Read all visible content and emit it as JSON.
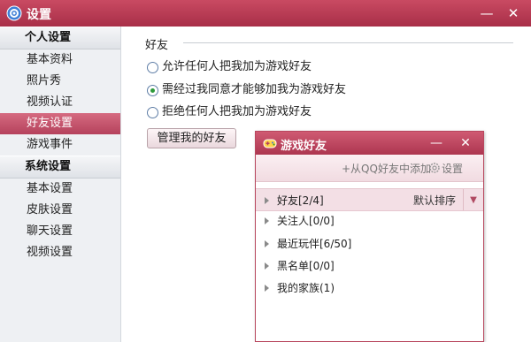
{
  "window": {
    "title": "设置",
    "minimize_glyph": "—",
    "close_glyph": "✕"
  },
  "sidebar": {
    "groups": [
      {
        "label": "个人设置",
        "items": [
          "基本资料",
          "照片秀",
          "视频认证",
          "好友设置",
          "游戏事件"
        ]
      },
      {
        "label": "系统设置",
        "items": [
          "基本设置",
          "皮肤设置",
          "聊天设置",
          "视频设置"
        ]
      }
    ],
    "active_item": "好友设置"
  },
  "main": {
    "section_title": "好友",
    "radio_options": [
      {
        "label": "允许任何人把我加为游戏好友",
        "checked": false
      },
      {
        "label": "需经过我同意才能够加我为游戏好友",
        "checked": true
      },
      {
        "label": "拒绝任何人把我加为游戏好友",
        "checked": false
      }
    ],
    "manage_button": "管理我的好友"
  },
  "popup": {
    "title": "游戏好友",
    "minimize_glyph": "—",
    "close_glyph": "✕",
    "add_label": "+从QQ好友中添加",
    "settings_label": "设置",
    "sort_label": "默认排序",
    "groups": [
      {
        "label": "好友[2/4]",
        "selected": true
      },
      {
        "label": "关注人[0/0]",
        "selected": false
      },
      {
        "label": "最近玩伴[6/50]",
        "selected": false
      },
      {
        "label": "黑名单[0/0]",
        "selected": false
      },
      {
        "label": "我的家族(1)",
        "selected": false
      }
    ]
  },
  "colors": {
    "accent": "#b5425c",
    "radio_checked": "#2d9a3a"
  }
}
